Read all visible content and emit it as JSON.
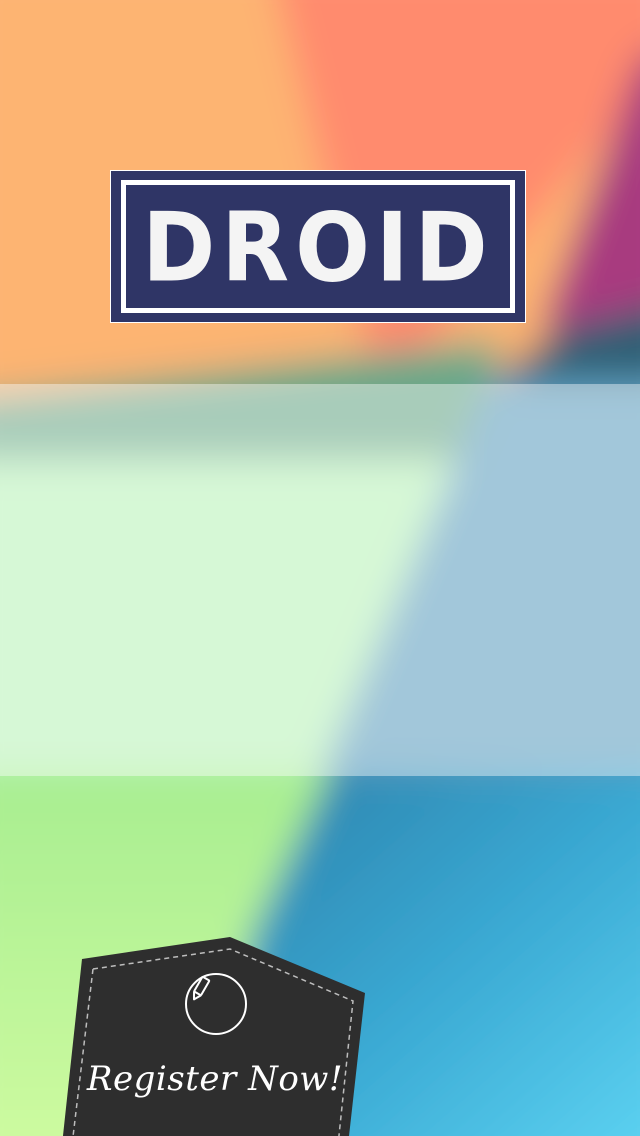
{
  "logo": {
    "text": "DROID",
    "background_color": "#2f3566",
    "border_color": "#ffffff"
  },
  "register": {
    "label": "Register Now!",
    "icon": "pencil-icon",
    "background_color": "#2e2e2e"
  },
  "colors": {
    "orange": "#fdb26e",
    "salmon": "#ff8a6d",
    "magenta": "#a8357e",
    "teal_dark": "#2f6c88",
    "light_green": "#c8f59a",
    "sky_blue": "#5cd2f0"
  }
}
